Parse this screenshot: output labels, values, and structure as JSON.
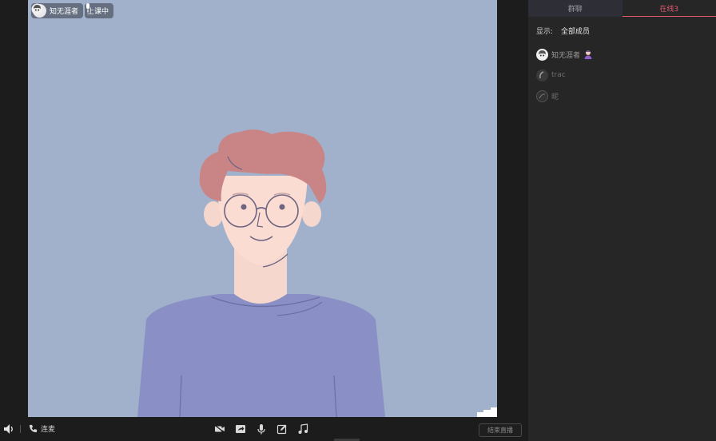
{
  "video": {
    "presenter_name": "知无涯者",
    "status_label": "上课中"
  },
  "toolbar": {
    "call_label": "连麦",
    "end_live_label": "结束直播"
  },
  "panel": {
    "tabs": [
      {
        "label": "群聊"
      },
      {
        "label": "在线3"
      }
    ],
    "filter": {
      "label": "显示:",
      "value": "全部成员"
    },
    "members": [
      {
        "name": "知无涯者"
      },
      {
        "name": "trac"
      },
      {
        "name": "昵"
      }
    ]
  },
  "colors": {
    "video_bg": "#a1b1cb",
    "active_tab": "#e05a6e",
    "panel_bg": "#262626"
  }
}
